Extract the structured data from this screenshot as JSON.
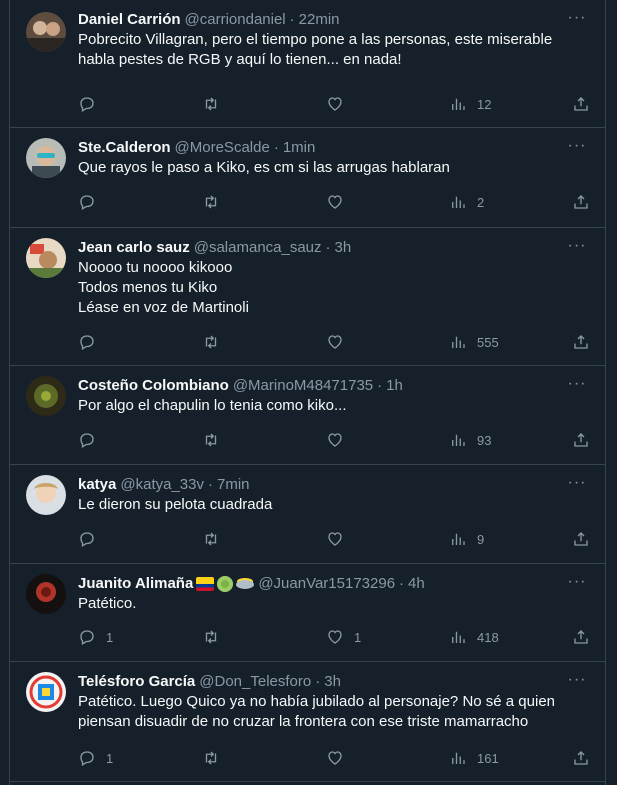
{
  "tweets": [
    {
      "name": "Daniel Carrión",
      "handle": "@carriondaniel",
      "time": "22min",
      "lines": [
        "Pobrecito Villagran, pero el tiempo pone a las personas, este miserable",
        "habla pestes de RGB y aquí lo tienen... en nada!"
      ],
      "replies": "",
      "likes": "",
      "views": "12",
      "avatar_color": "#6b5a4a"
    },
    {
      "name": "Ste.Calderon",
      "handle": "@MoreScalde",
      "time": "1min",
      "lines": [
        "Que rayos le paso a Kiko, es cm si las arrugas hablaran"
      ],
      "replies": "",
      "likes": "",
      "views": "2",
      "avatar_color": "#9aa3a0"
    },
    {
      "name": "Jean carlo sauz",
      "handle": "@salamanca_sauz",
      "time": "3h",
      "lines": [
        "Noooo tu noooo kikooo",
        "Todos menos tu Kiko",
        "Léase en voz de Martinoli"
      ],
      "replies": "",
      "likes": "",
      "views": "555",
      "avatar_color": "#c8a37a"
    },
    {
      "name": "Costeño Colombiano",
      "handle": "@MarinoM48471735",
      "time": "1h",
      "lines": [
        "Por algo el chapulin lo tenia como kiko..."
      ],
      "replies": "",
      "likes": "",
      "views": "93",
      "avatar_color": "#3b3a1c"
    },
    {
      "name": "katya",
      "handle": "@katya_33v",
      "time": "7min",
      "lines": [
        "Le dieron su pelota cuadrada"
      ],
      "replies": "",
      "likes": "",
      "views": "9",
      "avatar_color": "#cfd6dc"
    },
    {
      "name": "Juanito Alimaña",
      "handle": "@JuanVar15173296",
      "time": "4h",
      "lines": [
        "Patético."
      ],
      "replies": "1",
      "likes": "1",
      "views": "418",
      "avatar_color": "#1c1514"
    },
    {
      "name": "Telésforo García",
      "handle": "@Don_Telesforo",
      "time": "3h",
      "lines": [
        "Patético. Luego Quico ya no había jubilado al personaje? No sé a quien",
        "piensan disuadir de no cruzar la frontera con ese triste mamarracho"
      ],
      "replies": "1",
      "likes": "",
      "views": "161",
      "avatar_color": "#f2f2f2"
    }
  ],
  "separator": "·",
  "more_label": "···",
  "colors": {
    "background": "#15202b",
    "border": "#38444d",
    "muted": "#8b98a5",
    "text": "#f7f9f9"
  },
  "icons": [
    "reply-icon",
    "retweet-icon",
    "like-icon",
    "views-icon",
    "share-icon",
    "more-icon"
  ]
}
